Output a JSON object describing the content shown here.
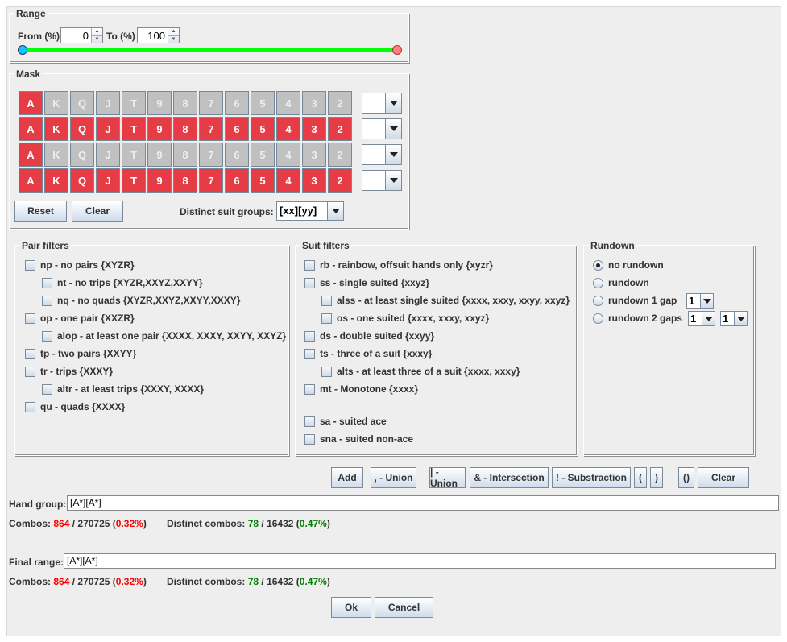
{
  "range": {
    "title": "Range",
    "from_label": "From (%)",
    "from_value": "0",
    "to_label": "To (%)",
    "to_value": "100",
    "slider_from_pct": 0,
    "slider_to_pct": 100,
    "track_color": "#00ff00",
    "from_knob_color": "#00ccff",
    "to_knob_color": "#ff8080"
  },
  "mask": {
    "title": "Mask",
    "ranks": [
      "A",
      "K",
      "Q",
      "J",
      "T",
      "9",
      "8",
      "7",
      "6",
      "5",
      "4",
      "3",
      "2"
    ],
    "rows": [
      [
        1,
        0,
        0,
        0,
        0,
        0,
        0,
        0,
        0,
        0,
        0,
        0,
        0
      ],
      [
        1,
        1,
        1,
        1,
        1,
        1,
        1,
        1,
        1,
        1,
        1,
        1,
        1
      ],
      [
        1,
        0,
        0,
        0,
        0,
        0,
        0,
        0,
        0,
        0,
        0,
        0,
        0
      ],
      [
        1,
        1,
        1,
        1,
        1,
        1,
        1,
        1,
        1,
        1,
        1,
        1,
        1
      ]
    ],
    "row_suit_values": [
      "",
      "",
      "",
      ""
    ],
    "on_color": "#e63c46",
    "off_color": "#c0c0c0",
    "reset_label": "Reset",
    "clear_label": "Clear",
    "distinct_label": "Distinct suit groups:",
    "distinct_value": "[xx][yy]"
  },
  "pair_filters": {
    "title": "Pair filters",
    "items": [
      {
        "label": "np - no pairs {XYZR}",
        "indent": 0,
        "checked": false
      },
      {
        "label": "nt - no trips {XYZR,XXYZ,XXYY}",
        "indent": 1,
        "checked": false
      },
      {
        "label": "nq - no quads {XYZR,XXYZ,XXYY,XXXY}",
        "indent": 1,
        "checked": false
      },
      {
        "label": "op - one pair {XXZR}",
        "indent": 0,
        "checked": false
      },
      {
        "label": "alop - at least one pair {XXXX, XXXY, XXYY, XXYZ}",
        "indent": 1,
        "checked": false
      },
      {
        "label": "tp - two pairs {XXYY}",
        "indent": 0,
        "checked": false
      },
      {
        "label": "tr - trips {XXXY}",
        "indent": 0,
        "checked": false
      },
      {
        "label": "altr - at least trips {XXXY, XXXX}",
        "indent": 1,
        "checked": false
      },
      {
        "label": "qu - quads {XXXX}",
        "indent": 0,
        "checked": false
      }
    ]
  },
  "suit_filters": {
    "title": "Suit filters",
    "items": [
      {
        "label": "rb - rainbow, offsuit hands only {xyzr}",
        "indent": 0,
        "checked": false
      },
      {
        "label": "ss - single suited {xxyz}",
        "indent": 0,
        "checked": false
      },
      {
        "label": "alss - at least single suited {xxxx, xxxy, xxyy, xxyz}",
        "indent": 1,
        "checked": false
      },
      {
        "label": "os - one suited {xxxx, xxxy, xxyz}",
        "indent": 1,
        "checked": false
      },
      {
        "label": "ds - double suited {xxyy}",
        "indent": 0,
        "checked": false
      },
      {
        "label": "ts - three of a suit {xxxy}",
        "indent": 0,
        "checked": false
      },
      {
        "label": "alts - at least three of a suit {xxxx, xxxy}",
        "indent": 1,
        "checked": false
      },
      {
        "label": "mt - Monotone {xxxx}",
        "indent": 0,
        "checked": false
      },
      {
        "label": "sa - suited ace",
        "indent": 0,
        "checked": false,
        "gap": true
      },
      {
        "label": "sna - suited non-ace",
        "indent": 0,
        "checked": false
      }
    ]
  },
  "rundown": {
    "title": "Rundown",
    "options": [
      {
        "label": "no rundown",
        "selected": true,
        "combos": []
      },
      {
        "label": "rundown",
        "selected": false,
        "combos": []
      },
      {
        "label": "rundown 1 gap",
        "selected": false,
        "combos": [
          "1"
        ]
      },
      {
        "label": "rundown 2 gaps",
        "selected": false,
        "combos": [
          "1",
          "1"
        ]
      }
    ]
  },
  "ops": {
    "buttons": [
      "Add",
      ", - Union",
      "| - Union",
      "& - Intersection",
      "! - Substraction",
      "(",
      ")",
      "()",
      "Clear"
    ]
  },
  "hand_group": {
    "label": "Hand group:",
    "value": "[A*][A*]",
    "combos_label": "Combos:",
    "combos": "864",
    "total": "270725",
    "pct": "0.32%",
    "distinct_label": "Distinct combos:",
    "distinct": "78",
    "distinct_total": "16432",
    "distinct_pct": "0.47%"
  },
  "final_range": {
    "label": "Final range:",
    "value": "[A*][A*]",
    "combos_label": "Combos:",
    "combos": "864",
    "total": "270725",
    "pct": "0.32%",
    "distinct_label": "Distinct combos:",
    "distinct": "78",
    "distinct_total": "16432",
    "distinct_pct": "0.47%"
  },
  "footer": {
    "ok_label": "Ok",
    "cancel_label": "Cancel"
  }
}
